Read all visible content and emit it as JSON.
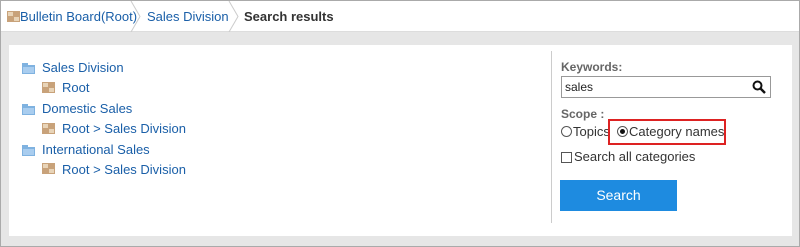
{
  "breadcrumb": {
    "items": [
      {
        "label": "Bulletin Board(Root)"
      },
      {
        "label": "Sales Division"
      },
      {
        "label": "Search results"
      }
    ]
  },
  "results": [
    {
      "title": "Sales Division",
      "path": "Root"
    },
    {
      "title": "Domestic Sales",
      "path": "Root > Sales Division"
    },
    {
      "title": "International Sales",
      "path": "Root > Sales Division"
    }
  ],
  "search": {
    "keywords_label": "Keywords:",
    "keywords_value": "sales",
    "scope_label": "Scope :",
    "scope_options": [
      {
        "label": "Topics",
        "selected": false
      },
      {
        "label": "Category names",
        "selected": true
      }
    ],
    "search_all_label": "Search all categories",
    "search_all_checked": false,
    "button_label": "Search"
  },
  "colors": {
    "link": "#1a5fa8",
    "button": "#1e8be0",
    "highlight": "#dd2222"
  }
}
